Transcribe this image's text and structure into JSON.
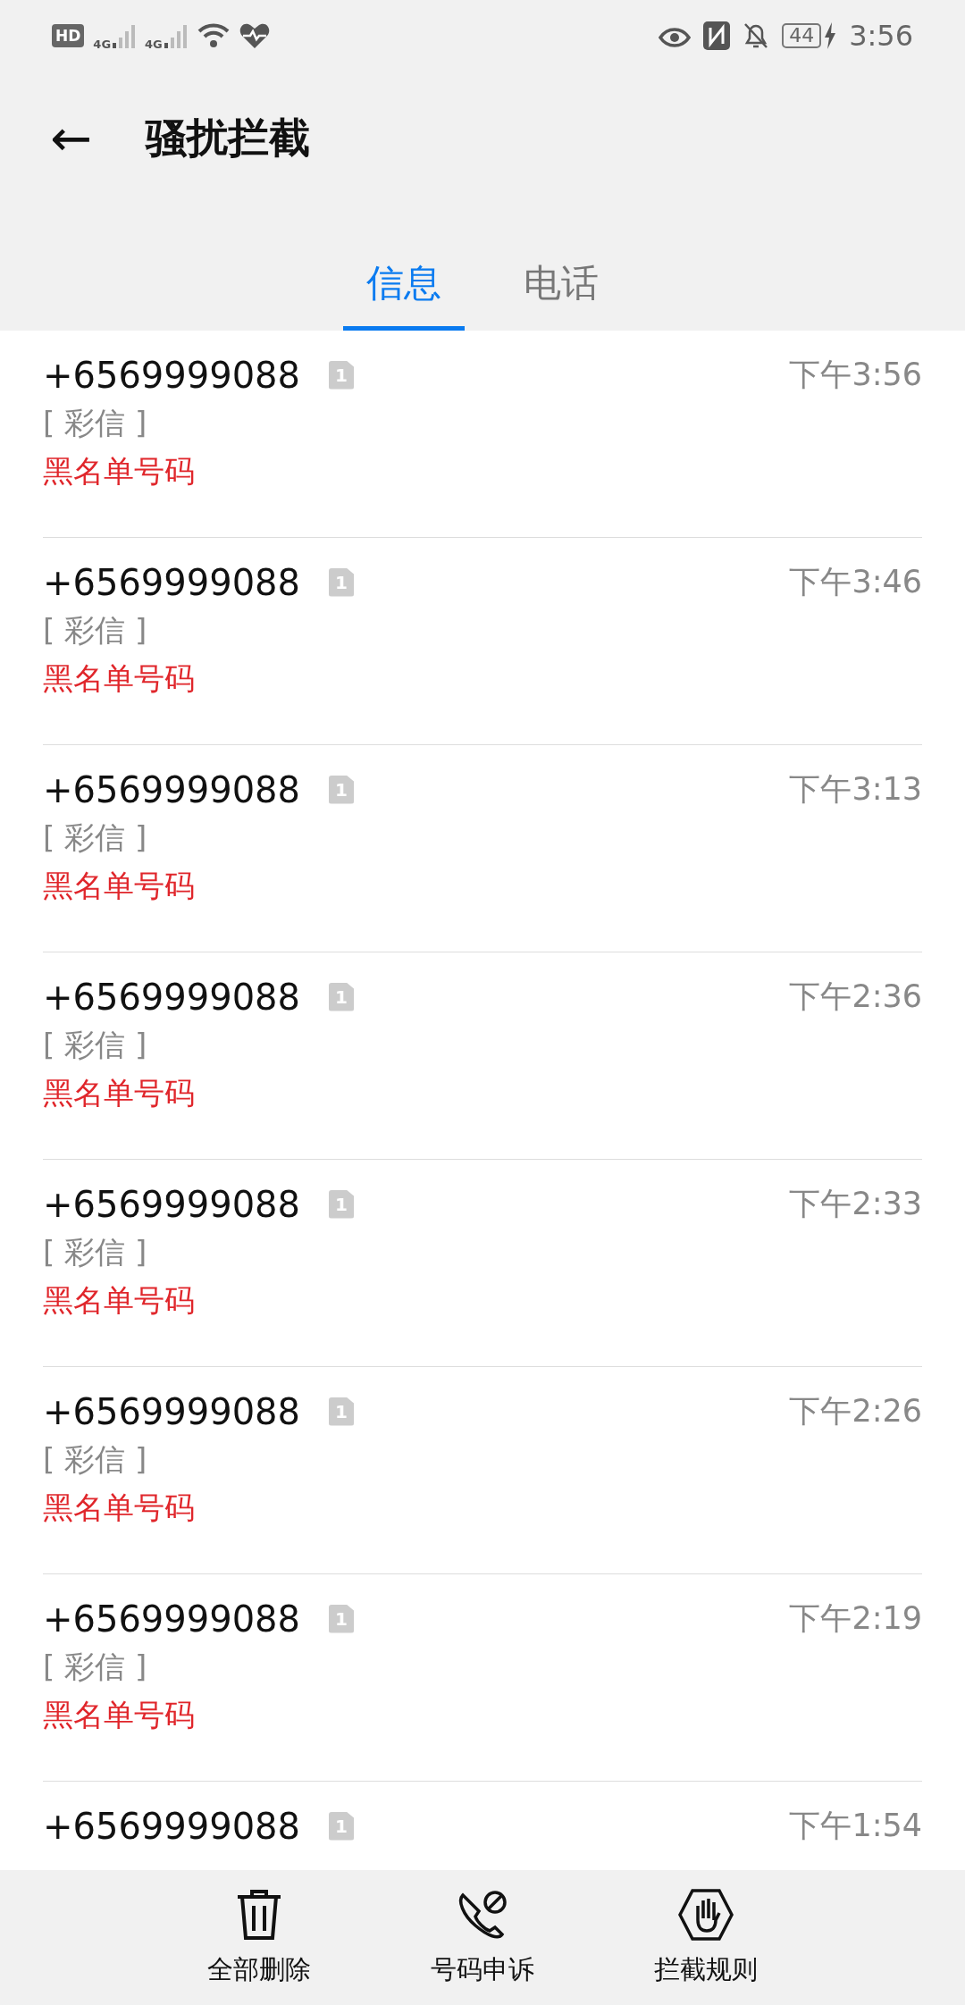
{
  "status_bar": {
    "hd": "HD",
    "networks": [
      "4G",
      "4G"
    ],
    "battery": "44",
    "charging": true,
    "time": "3:56"
  },
  "header": {
    "back": "←",
    "title": "骚扰拦截"
  },
  "tabs": [
    {
      "label": "信息",
      "selected": true
    },
    {
      "label": "电话",
      "selected": false
    }
  ],
  "messages": [
    {
      "number": "+6569999088",
      "sim": "1",
      "time": "下午3:56",
      "type": "[ 彩信 ]",
      "reason": "黑名单号码"
    },
    {
      "number": "+6569999088",
      "sim": "1",
      "time": "下午3:46",
      "type": "[ 彩信 ]",
      "reason": "黑名单号码"
    },
    {
      "number": "+6569999088",
      "sim": "1",
      "time": "下午3:13",
      "type": "[ 彩信 ]",
      "reason": "黑名单号码"
    },
    {
      "number": "+6569999088",
      "sim": "1",
      "time": "下午2:36",
      "type": "[ 彩信 ]",
      "reason": "黑名单号码"
    },
    {
      "number": "+6569999088",
      "sim": "1",
      "time": "下午2:33",
      "type": "[ 彩信 ]",
      "reason": "黑名单号码"
    },
    {
      "number": "+6569999088",
      "sim": "1",
      "time": "下午2:26",
      "type": "[ 彩信 ]",
      "reason": "黑名单号码"
    },
    {
      "number": "+6569999088",
      "sim": "1",
      "time": "下午2:19",
      "type": "[ 彩信 ]",
      "reason": "黑名单号码"
    },
    {
      "number": "+6569999088",
      "sim": "1",
      "time": "下午1:54"
    }
  ],
  "actions": [
    {
      "kind": "delete",
      "label": "全部删除"
    },
    {
      "kind": "appeal",
      "label": "号码申诉"
    },
    {
      "kind": "rules",
      "label": "拦截规则"
    }
  ]
}
